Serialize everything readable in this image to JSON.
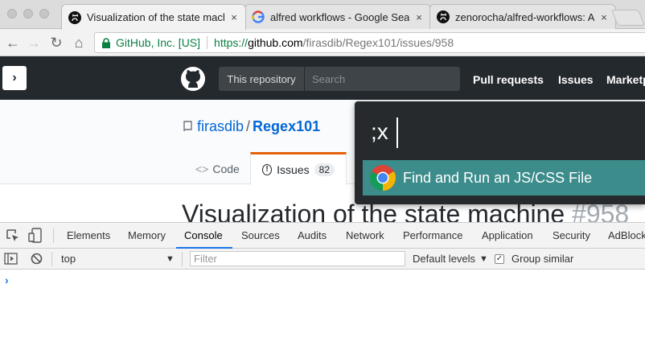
{
  "browser": {
    "tabs": [
      {
        "title": "Visualization of the state machine",
        "close": "×"
      },
      {
        "title": "alfred workflows - Google Search",
        "close": "×"
      },
      {
        "title": "zenorocha/alfred-workflows: A",
        "close": "×"
      }
    ],
    "nav": {
      "back": "←",
      "forward": "→",
      "reload": "↻",
      "home": "⌂"
    },
    "omnibox": {
      "org": "GitHub, Inc. [US]",
      "url_scheme": "https://",
      "url_host": "github.com",
      "url_path": "/firasdib/Regex101/issues/958"
    }
  },
  "github": {
    "sidebar_toggle": "›",
    "scope": "This repository",
    "search_placeholder": "Search",
    "links": [
      "Pull requests",
      "Issues",
      "Marketplace"
    ],
    "repo": {
      "owner": "firasdib",
      "separator": "/",
      "name": "Regex101"
    },
    "repo_tabs": [
      {
        "icon": "<>",
        "label": "Code"
      },
      {
        "icon": "!",
        "label": "Issues",
        "count": "82"
      }
    ],
    "issue": {
      "title": "Visualization of the state machine",
      "number": "#958"
    }
  },
  "alfred": {
    "query": ";x",
    "result": "Find and Run an JS/CSS File"
  },
  "devtools": {
    "tabs": [
      "Elements",
      "Memory",
      "Console",
      "Sources",
      "Audits",
      "Network",
      "Performance",
      "Application",
      "Security",
      "AdBlock"
    ],
    "active_tab": "Console",
    "context": "top",
    "filter_placeholder": "Filter",
    "levels": "Default levels",
    "group_similar": "Group similar",
    "prompt": "›"
  },
  "colors": {
    "github_header": "#24292e",
    "alfred_bg": "#262a2d",
    "alfred_result": "#3c8c8c",
    "issues_tab_accent": "#e36209",
    "secure_green": "#0b8043",
    "link_blue": "#0366d6"
  }
}
